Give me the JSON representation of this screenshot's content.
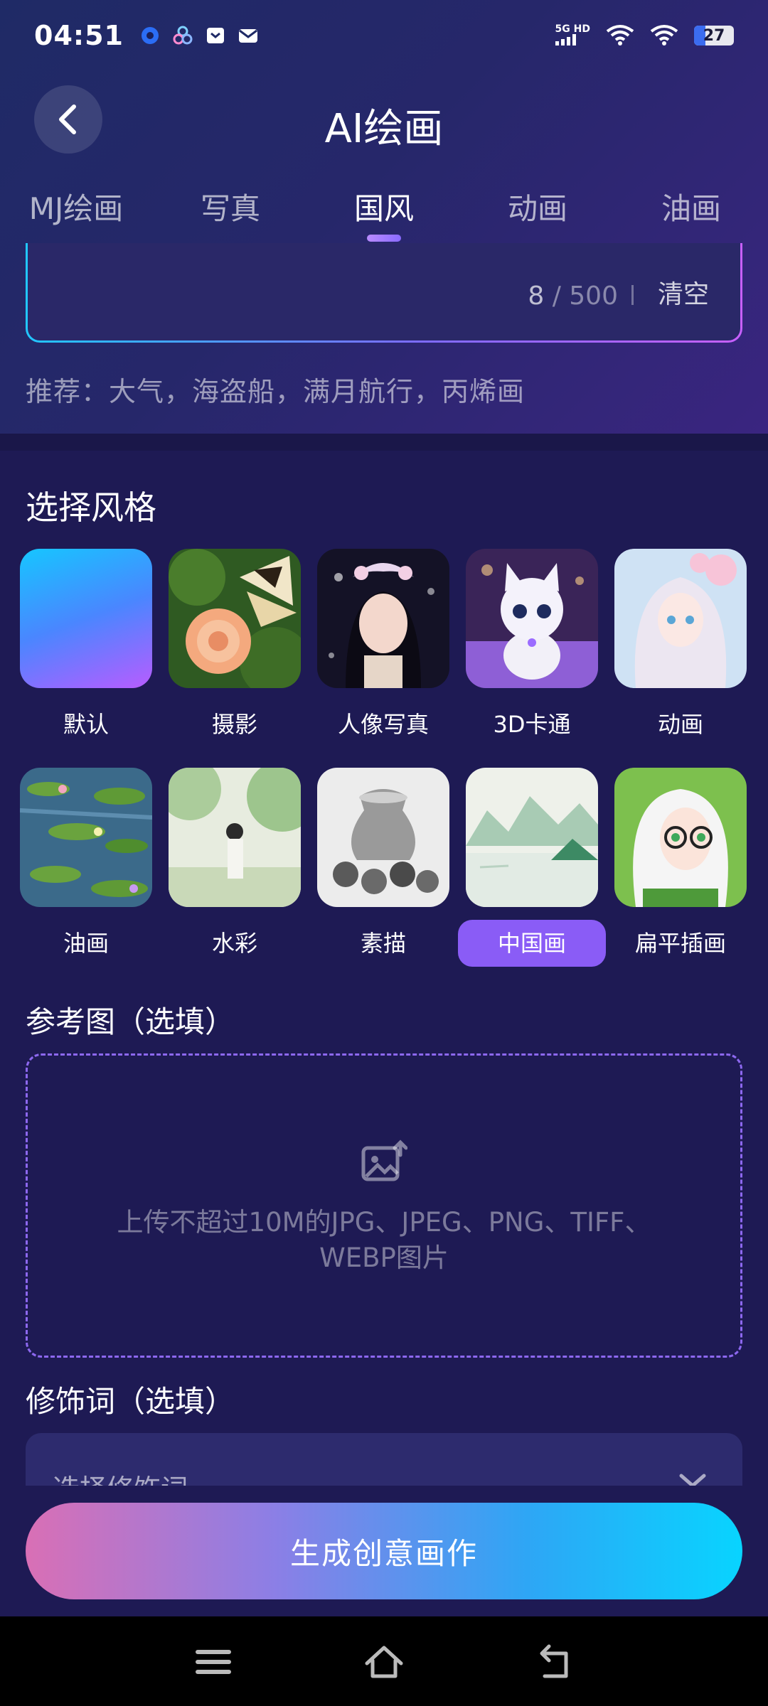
{
  "status_bar": {
    "time": "04:51",
    "network": "5G HD",
    "battery": "27"
  },
  "header": {
    "title": "AI绘画"
  },
  "tabs": [
    {
      "label": "MJ绘画",
      "active": false
    },
    {
      "label": "写真",
      "active": false
    },
    {
      "label": "国风",
      "active": true
    },
    {
      "label": "动画",
      "active": false
    },
    {
      "label": "油画",
      "active": false
    }
  ],
  "prompt": {
    "count": "8",
    "separator": "/",
    "max": "500",
    "clear_label": "清空"
  },
  "recommend": "推荐：大气，海盗船，满月航行，丙烯画",
  "styles": {
    "title": "选择风格",
    "items": [
      {
        "label": "默认",
        "selected": false
      },
      {
        "label": "摄影",
        "selected": false
      },
      {
        "label": "人像写真",
        "selected": false
      },
      {
        "label": "3D卡通",
        "selected": false
      },
      {
        "label": "动画",
        "selected": false
      },
      {
        "label": "油画",
        "selected": false
      },
      {
        "label": "水彩",
        "selected": false
      },
      {
        "label": "素描",
        "selected": false
      },
      {
        "label": "中国画",
        "selected": true
      },
      {
        "label": "扁平插画",
        "selected": false
      }
    ]
  },
  "reference": {
    "title": "参考图（选填）",
    "upload_text_line1": "上传不超过10M的JPG、JPEG、PNG、TIFF、",
    "upload_text_line2": "WEBP图片"
  },
  "modifier": {
    "title": "修饰词（选填）",
    "placeholder": "选择修饰词"
  },
  "cta": {
    "label": "生成创意画作"
  },
  "colors": {
    "accent": "#8a5cf6",
    "background": "#1e1a54"
  }
}
